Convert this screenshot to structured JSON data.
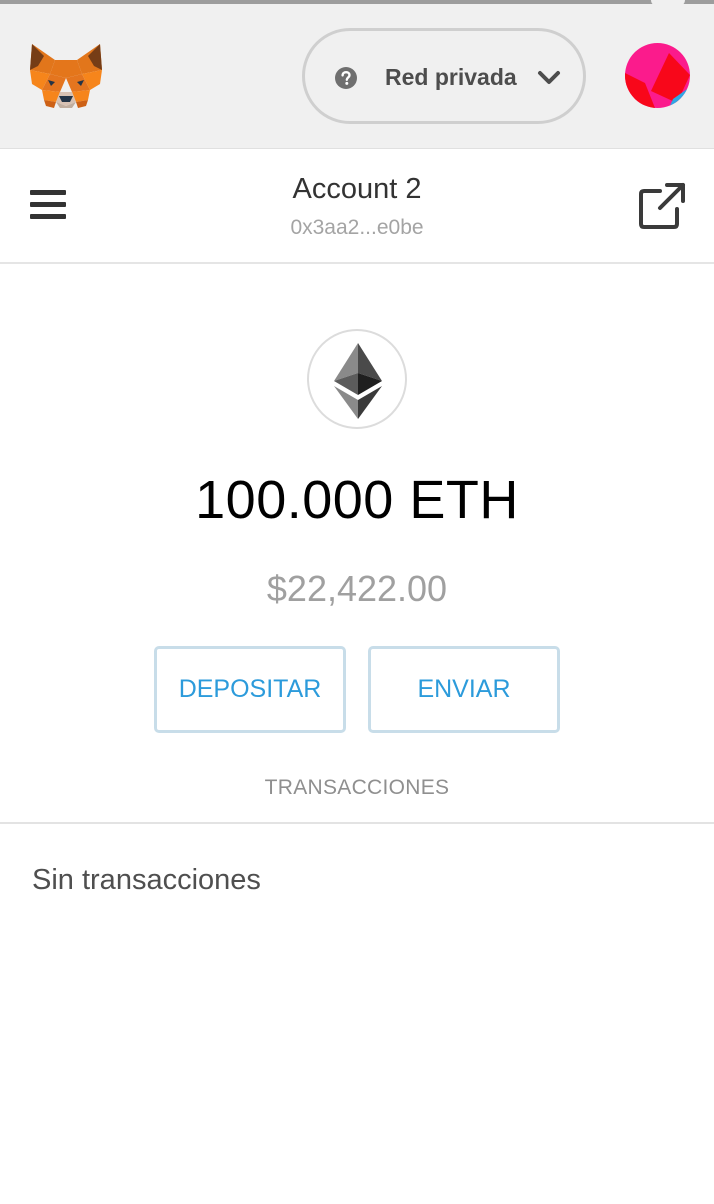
{
  "header": {
    "network_label": "Red privada"
  },
  "account": {
    "name": "Account 2",
    "address": "0x3aa2...e0be"
  },
  "balance": {
    "amount": "100.000 ETH",
    "fiat": "$22,422.00"
  },
  "actions": {
    "deposit_label": "DEPOSITAR",
    "send_label": "ENVIAR"
  },
  "transactions": {
    "tab_label": "TRANSACCIONES",
    "empty_message": "Sin transacciones"
  },
  "icons": {
    "logo": "metamask-fox-icon",
    "help": "question-circle-icon",
    "chevron": "chevron-down-icon",
    "avatar": "identicon-avatar",
    "menu": "hamburger-menu-icon",
    "external": "external-link-icon",
    "token": "ethereum-icon"
  },
  "colors": {
    "app_bar_bg": "#f0f0f0",
    "button_text": "#2c9bdb",
    "button_border": "#c8dde9",
    "fox_orange": "#f6851b",
    "avatar_pink": "#fb1b8c",
    "avatar_red": "#f8071a",
    "avatar_blue": "#2fa7e5"
  }
}
